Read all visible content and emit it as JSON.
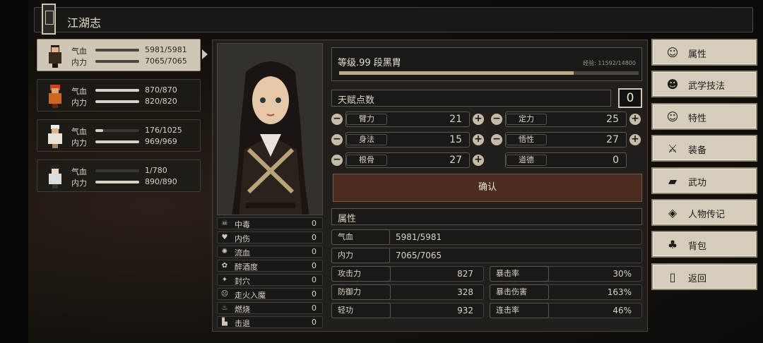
{
  "title": "江湖志",
  "characters": [
    {
      "hp_label": "气血",
      "hp": "5981/5981",
      "hp_frac": 1.0,
      "mp_label": "内力",
      "mp": "7065/7065",
      "mp_frac": 1.0,
      "selected": true
    },
    {
      "hp_label": "气血",
      "hp": "870/870",
      "hp_frac": 1.0,
      "mp_label": "内力",
      "mp": "820/820",
      "mp_frac": 1.0,
      "selected": false
    },
    {
      "hp_label": "气血",
      "hp": "176/1025",
      "hp_frac": 0.17,
      "mp_label": "内力",
      "mp": "969/969",
      "mp_frac": 1.0,
      "selected": false
    },
    {
      "hp_label": "气血",
      "hp": "1/780",
      "hp_frac": 0.0,
      "mp_label": "内力",
      "mp": "890/890",
      "mp_frac": 1.0,
      "selected": false
    }
  ],
  "status_effects": [
    {
      "icon": "poison-icon",
      "glyph": "☠",
      "label": "中毒",
      "value": "0"
    },
    {
      "icon": "broken-heart-icon",
      "glyph": "♥",
      "label": "内伤",
      "value": "0"
    },
    {
      "icon": "bleed-icon",
      "glyph": "✺",
      "label": "流血",
      "value": "0"
    },
    {
      "icon": "drunk-icon",
      "glyph": "✿",
      "label": "醉酒度",
      "value": "0"
    },
    {
      "icon": "seal-icon",
      "glyph": "✦",
      "label": "封穴",
      "value": "0"
    },
    {
      "icon": "madness-icon",
      "glyph": "☹",
      "label": "走火入魔",
      "value": "0"
    },
    {
      "icon": "burn-icon",
      "glyph": "♨",
      "label": "燃烧",
      "value": "0"
    },
    {
      "icon": "knockback-icon",
      "glyph": "▙",
      "label": "击退",
      "value": "0"
    }
  ],
  "level": {
    "text": "等级.99  段黑胄",
    "exp": "经验: 11592/14800",
    "exp_frac": 0.783
  },
  "talent": {
    "label": "天赋点数",
    "value": "0"
  },
  "attributes": {
    "bili": {
      "label": "臂力",
      "value": "21"
    },
    "dingli": {
      "label": "定力",
      "value": "25"
    },
    "shenfa": {
      "label": "身法",
      "value": "15"
    },
    "wuxing": {
      "label": "悟性",
      "value": "27"
    },
    "gengu": {
      "label": "根骨",
      "value": "27"
    },
    "daode": {
      "label": "道德",
      "value": "0"
    }
  },
  "confirm_label": "确认",
  "props_header": "属性",
  "props": {
    "hp": {
      "label": "气血",
      "value": "5981/5981"
    },
    "mp": {
      "label": "内力",
      "value": "7065/7065"
    },
    "atk": {
      "label": "攻击力",
      "value": "827"
    },
    "crit": {
      "label": "暴击率",
      "value": "30%"
    },
    "def": {
      "label": "防御力",
      "value": "328"
    },
    "critdmg": {
      "label": "暴击伤害",
      "value": "163%"
    },
    "qinggong": {
      "label": "轻功",
      "value": "932"
    },
    "combo": {
      "label": "连击率",
      "value": "46%"
    }
  },
  "menu": [
    {
      "icon": "character-icon",
      "glyph": "☺",
      "label": "属性"
    },
    {
      "icon": "skills-icon",
      "glyph": "☻",
      "label": "武学技法"
    },
    {
      "icon": "traits-icon",
      "glyph": "☺",
      "label": "特性"
    },
    {
      "icon": "sword-icon",
      "glyph": "⚔",
      "label": "装备"
    },
    {
      "icon": "book-icon",
      "glyph": "▰",
      "label": "武功"
    },
    {
      "icon": "biography-icon",
      "glyph": "◈",
      "label": "人物传记"
    },
    {
      "icon": "bag-icon",
      "glyph": "♣",
      "label": "背包"
    },
    {
      "icon": "door-icon",
      "glyph": "▯",
      "label": "返回"
    }
  ]
}
